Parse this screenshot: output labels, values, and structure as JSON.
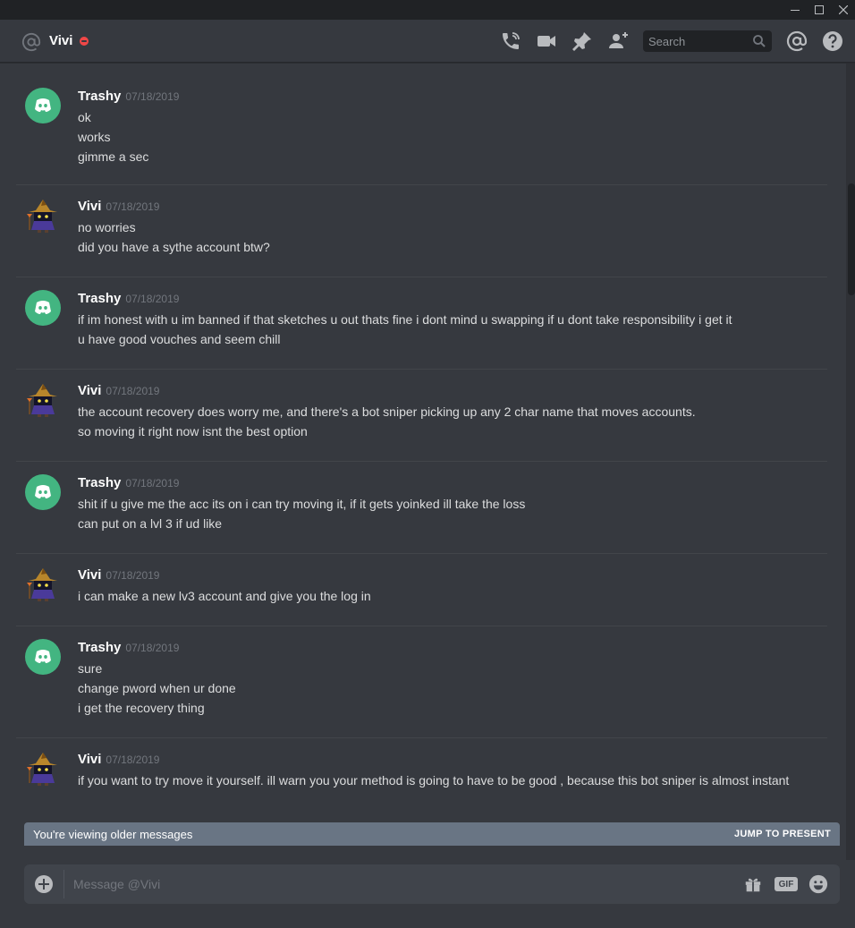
{
  "window": {
    "controls": [
      "minimize",
      "maximize",
      "close"
    ]
  },
  "header": {
    "title": "Vivi",
    "status": "do-not-disturb",
    "search_placeholder": "Search",
    "icons": [
      "at-icon",
      "phone-call-icon",
      "video-call-icon",
      "pin-icon",
      "add-friend-icon",
      "search-icon",
      "mention-icon",
      "help-icon"
    ]
  },
  "messages": [
    {
      "author": "Trashy",
      "timestamp": "07/18/2019",
      "avatar": "discord-logo",
      "lines": [
        "ok",
        "works",
        "gimme a sec"
      ]
    },
    {
      "author": "Vivi",
      "timestamp": "07/18/2019",
      "avatar": "black-mage",
      "lines": [
        "no worries",
        "did you have a sythe account btw?"
      ]
    },
    {
      "author": "Trashy",
      "timestamp": "07/18/2019",
      "avatar": "discord-logo",
      "lines": [
        "if im honest with u im banned if that sketches u out thats fine i dont mind u swapping if u dont take responsibility i get it",
        "u have good vouches and seem chill"
      ]
    },
    {
      "author": "Vivi",
      "timestamp": "07/18/2019",
      "avatar": "black-mage",
      "lines": [
        "the account recovery does worry me, and there's a bot sniper picking up any 2 char name that moves accounts.",
        "so moving it right now isnt the best option"
      ]
    },
    {
      "author": "Trashy",
      "timestamp": "07/18/2019",
      "avatar": "discord-logo",
      "lines": [
        "shit if u give me the acc its on i can try moving it, if it gets yoinked ill take the loss",
        "can put on a lvl 3 if ud like"
      ]
    },
    {
      "author": "Vivi",
      "timestamp": "07/18/2019",
      "avatar": "black-mage",
      "lines": [
        "i can make a new lv3 account and give you the log in"
      ]
    },
    {
      "author": "Trashy",
      "timestamp": "07/18/2019",
      "avatar": "discord-logo",
      "lines": [
        "sure",
        "change pword when ur done",
        "i get the recovery thing"
      ]
    },
    {
      "author": "Vivi",
      "timestamp": "07/18/2019",
      "avatar": "black-mage",
      "lines": [
        "if you want to try move it yourself. ill warn you your method is going to have to be good , because this bot sniper is almost instant"
      ]
    }
  ],
  "older_banner": {
    "text": "You're viewing older messages",
    "action": "JUMP TO PRESENT"
  },
  "composer": {
    "placeholder": "Message @Vivi",
    "gif_label": "GIF",
    "icons": [
      "add-attachment-icon",
      "gift-icon",
      "gif-icon",
      "emoji-icon"
    ]
  },
  "colors": {
    "background": "#36393f",
    "discord_avatar": "#43b581",
    "dnd_status": "#f04747",
    "banner": "#697584",
    "composer": "#40444b"
  }
}
